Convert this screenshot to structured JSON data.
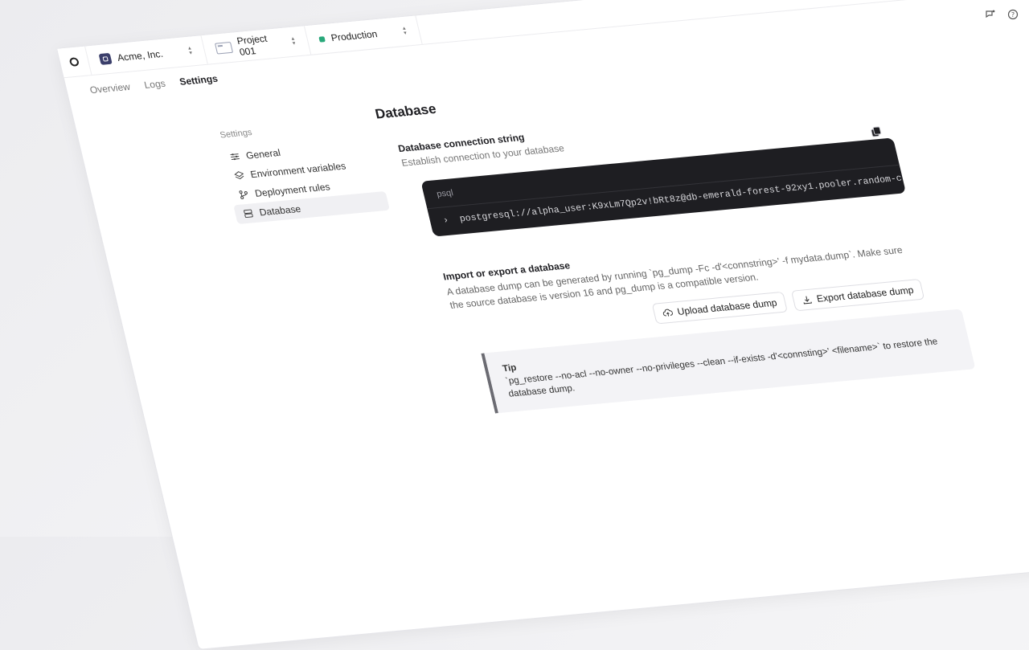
{
  "corner_icons": [
    "feedback-icon",
    "help-icon"
  ],
  "topbar": {
    "org": "Acme, Inc.",
    "project": "Project 001",
    "environment": "Production"
  },
  "tabs": [
    {
      "label": "Overview",
      "active": false
    },
    {
      "label": "Logs",
      "active": false
    },
    {
      "label": "Settings",
      "active": true
    }
  ],
  "sidebar": {
    "heading": "Settings",
    "items": [
      {
        "label": "General",
        "icon": "sliders-icon",
        "active": false
      },
      {
        "label": "Environment variables",
        "icon": "layers-icon",
        "active": false
      },
      {
        "label": "Deployment rules",
        "icon": "branch-icon",
        "active": false
      },
      {
        "label": "Database",
        "icon": "database-icon",
        "active": true
      }
    ]
  },
  "main": {
    "title": "Database",
    "connection": {
      "title": "Database connection string",
      "subtitle": "Establish connection to your database",
      "lang": "psql",
      "prompt": "›",
      "value": "postgresql://alpha_user:K9xLm7Qp2v!bRt8z@db-emerald-forest-92xy1.pooler.random-cloud.net/ap…"
    },
    "import_export": {
      "title": "Import or export a database",
      "description": "A database dump can be generated by running `pg_dump -Fc -d'<connstring>' -f mydata.dump`. Make sure the source database is version 16 and pg_dump is a compatible version.",
      "upload_label": "Upload database dump",
      "export_label": "Export database dump"
    },
    "tip": {
      "title": "Tip",
      "text": "`pg_restore --no-acl --no-owner --no-privileges --clean --if-exists -d'<connsting>' <filename>` to restore the database dump."
    }
  },
  "colors": {
    "status_green": "#28a87a",
    "code_bg": "#1e1e22"
  }
}
